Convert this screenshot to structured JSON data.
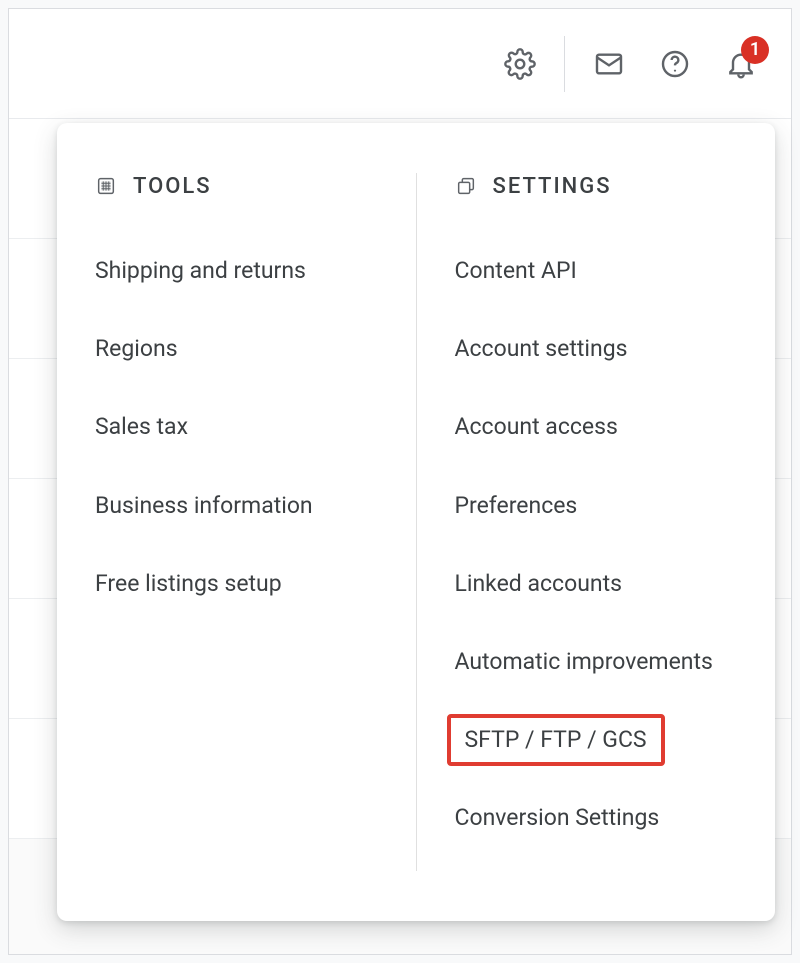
{
  "topbar": {
    "notifications_count": "1"
  },
  "dropdown": {
    "columns": [
      {
        "title": "TOOLS",
        "items": [
          {
            "label": "Shipping and returns",
            "highlight": false
          },
          {
            "label": "Regions",
            "highlight": false
          },
          {
            "label": "Sales tax",
            "highlight": false
          },
          {
            "label": "Business information",
            "highlight": false
          },
          {
            "label": "Free listings setup",
            "highlight": false
          }
        ]
      },
      {
        "title": "SETTINGS",
        "items": [
          {
            "label": "Content API",
            "highlight": false
          },
          {
            "label": "Account settings",
            "highlight": false
          },
          {
            "label": "Account access",
            "highlight": false
          },
          {
            "label": "Preferences",
            "highlight": false
          },
          {
            "label": "Linked accounts",
            "highlight": false
          },
          {
            "label": "Automatic improvements",
            "highlight": false
          },
          {
            "label": "SFTP / FTP / GCS",
            "highlight": true
          },
          {
            "label": "Conversion Settings",
            "highlight": false
          }
        ]
      }
    ]
  }
}
